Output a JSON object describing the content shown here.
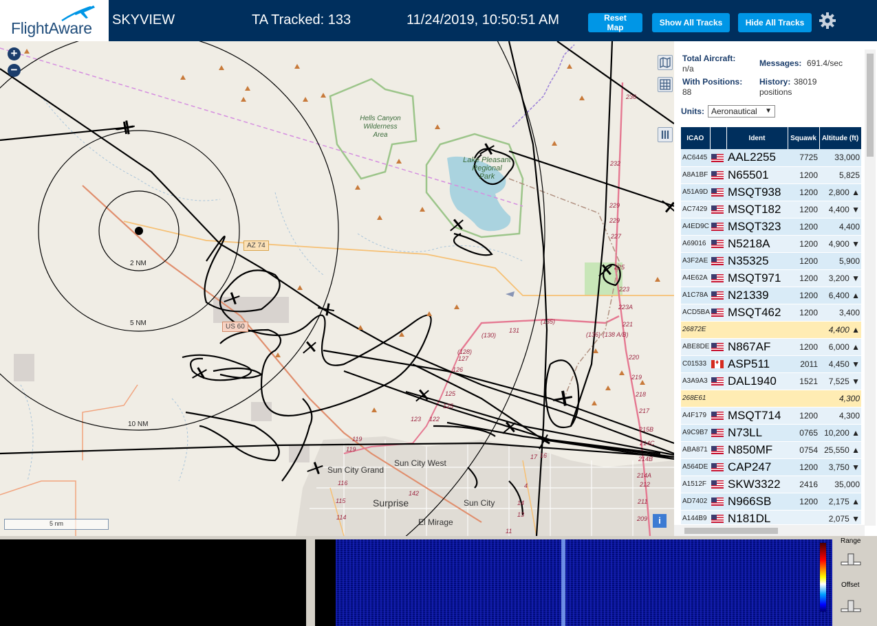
{
  "header": {
    "logo_text": "FlightAware",
    "app_title": "SKYVIEW",
    "ta_tracked": "TA Tracked: 133",
    "clock": "11/24/2019, 10:50:51 AM",
    "buttons": {
      "reset_map": "Reset Map",
      "show_all_tracks": "Show All Tracks",
      "hide_all_tracks": "Hide All Tracks"
    },
    "settings_icon": "gear-icon"
  },
  "map": {
    "zoom_in": "+",
    "zoom_out": "−",
    "scale_bar": "5 nm",
    "info_button": "i",
    "range_rings": [
      "2 NM",
      "5 NM",
      "10 NM"
    ],
    "place_labels": {
      "hells_canyon": [
        "Hells Canyon",
        "Wilderness",
        "Area"
      ],
      "lake_pleasant": [
        "Lake Pleasant",
        "Regional",
        "Park"
      ],
      "sun_city_grand": "Sun City Grand",
      "sun_city_west": "Sun City West",
      "surprise": "Surprise",
      "sun_city": "Sun City",
      "el_mirage": "El Mirage"
    },
    "road_labels": [
      "AZ 74",
      "US 60"
    ],
    "route_numbers": [
      "236",
      "232",
      "229",
      "229",
      "227",
      "225",
      "223",
      "223A",
      "221",
      "220",
      "219",
      "218",
      "217",
      "215B",
      "214C",
      "214B",
      "214A",
      "212",
      "211",
      "209",
      "131",
      "(130)",
      "(135)",
      "(136)",
      "(138 A/B)",
      "(128)",
      "127",
      "126",
      "125",
      "125",
      "123",
      "122",
      "119",
      "119",
      "116",
      "115",
      "114",
      "142",
      "16",
      "14",
      "13",
      "11",
      "17",
      "4"
    ]
  },
  "panel": {
    "total_aircraft_label": "Total Aircraft:",
    "total_aircraft_value": "n/a",
    "messages_label": "Messages:",
    "messages_value": "691.4/sec",
    "with_positions_label": "With Positions:",
    "with_positions_value": "88",
    "history_label": "History:",
    "history_value": "38019",
    "history_unit": "positions",
    "units_label": "Units:",
    "units_value": "Aeronautical",
    "columns": [
      "ICAO",
      "",
      "Ident",
      "Squawk",
      "Altitude (ft)"
    ],
    "rows": [
      {
        "icao": "AC6445",
        "flag": "us",
        "ident": "AAL2255",
        "squawk": "7725",
        "alt": "33,000"
      },
      {
        "icao": "A8A1BF",
        "flag": "us",
        "ident": "N65501",
        "squawk": "1200",
        "alt": "5,825"
      },
      {
        "icao": "A51A9D",
        "flag": "us",
        "ident": "MSQT938",
        "squawk": "1200",
        "alt": "2,800 ▲"
      },
      {
        "icao": "AC7429",
        "flag": "us",
        "ident": "MSQT182",
        "squawk": "1200",
        "alt": "4,400 ▼"
      },
      {
        "icao": "A4ED9C",
        "flag": "us",
        "ident": "MSQT323",
        "squawk": "1200",
        "alt": "4,400"
      },
      {
        "icao": "A69016",
        "flag": "us",
        "ident": "N5218A",
        "squawk": "1200",
        "alt": "4,900 ▼"
      },
      {
        "icao": "A3F2AE",
        "flag": "us",
        "ident": "N35325",
        "squawk": "1200",
        "alt": "5,900"
      },
      {
        "icao": "A4E62A",
        "flag": "us",
        "ident": "MSQT971",
        "squawk": "1200",
        "alt": "3,200 ▼"
      },
      {
        "icao": "A1C78A",
        "flag": "us",
        "ident": "N21339",
        "squawk": "1200",
        "alt": "6,400 ▲"
      },
      {
        "icao": "ACD5BA",
        "flag": "us",
        "ident": "MSQT462",
        "squawk": "1200",
        "alt": "3,400"
      },
      {
        "icao": "26872E",
        "flag": "",
        "ident": "",
        "squawk": "",
        "alt": "4,400 ▲",
        "tisb": true
      },
      {
        "icao": "ABE8DE",
        "flag": "us",
        "ident": "N867AF",
        "squawk": "1200",
        "alt": "6,000 ▲"
      },
      {
        "icao": "C01533",
        "flag": "ca",
        "ident": "ASP511",
        "squawk": "2011",
        "alt": "4,450 ▼"
      },
      {
        "icao": "A3A9A3",
        "flag": "us",
        "ident": "DAL1940",
        "squawk": "1521",
        "alt": "7,525 ▼"
      },
      {
        "icao": "268E61",
        "flag": "",
        "ident": "",
        "squawk": "",
        "alt": "4,300",
        "tisb": true
      },
      {
        "icao": "A4F179",
        "flag": "us",
        "ident": "MSQT714",
        "squawk": "1200",
        "alt": "4,300"
      },
      {
        "icao": "A9C9B7",
        "flag": "us",
        "ident": "N73LL",
        "squawk": "0765",
        "alt": "10,200 ▲"
      },
      {
        "icao": "ABA871",
        "flag": "us",
        "ident": "N850MF",
        "squawk": "0754",
        "alt": "25,550 ▲"
      },
      {
        "icao": "A564DE",
        "flag": "us",
        "ident": "CAP247",
        "squawk": "1200",
        "alt": "3,750 ▼"
      },
      {
        "icao": "A1512F",
        "flag": "us",
        "ident": "SKW3322",
        "squawk": "2416",
        "alt": "35,000"
      },
      {
        "icao": "AD7402",
        "flag": "us",
        "ident": "N966SB",
        "squawk": "1200",
        "alt": "2,175 ▲"
      },
      {
        "icao": "A144B9",
        "flag": "us",
        "ident": "N181DL",
        "squawk": "",
        "alt": "2,075 ▼"
      }
    ]
  },
  "spectrum": {
    "range_label": "Range",
    "offset_label": "Offset"
  }
}
